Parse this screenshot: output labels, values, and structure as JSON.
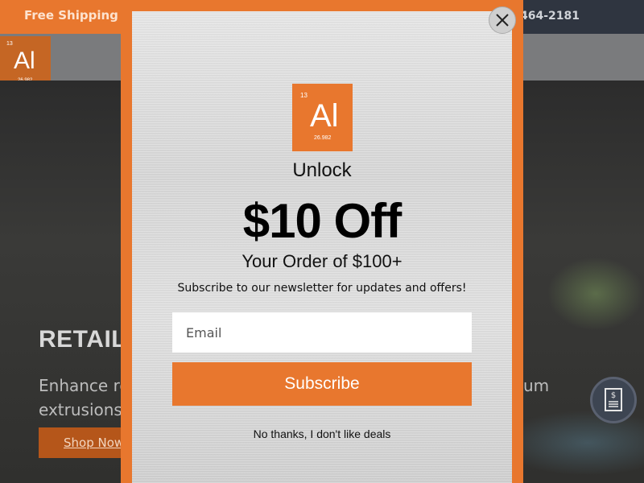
{
  "topbar": {
    "shipping_text": "Free Shipping o",
    "phone_text": "464-2181"
  },
  "site_logo": {
    "number": "13",
    "symbol": "Al",
    "mass": "26.982"
  },
  "hero": {
    "title": "RETAIL S",
    "text_line1": "Enhance re",
    "text_line2": "extrusions.",
    "text_right": "um",
    "shop_button": "Shop Now"
  },
  "modal": {
    "logo": {
      "number": "13",
      "symbol": "Al",
      "mass": "26.982"
    },
    "unlock": "Unlock",
    "headline": "$10 Off",
    "subhead": "Your Order of $100+",
    "description": "Subscribe to our newsletter for updates and offers!",
    "email_placeholder": "Email",
    "subscribe_label": "Subscribe",
    "decline_label": "No thanks, I don't like deals",
    "close_icon": "close-icon"
  },
  "fab": {
    "icon": "document-dollar-icon"
  },
  "colors": {
    "accent": "#e8772e",
    "dark": "#2f3540"
  }
}
